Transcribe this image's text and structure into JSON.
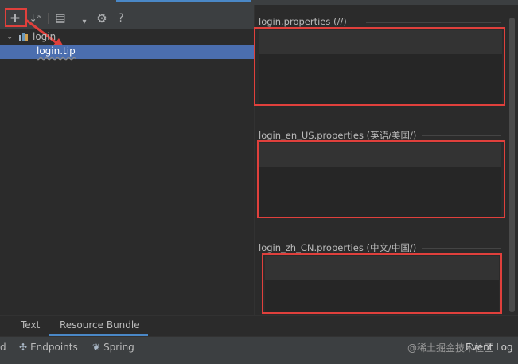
{
  "toolbar": {
    "add_icon": "+",
    "sort_icon": "↓ᵃ",
    "bundle_icon": "▤",
    "dropdown_icon": "▾",
    "gear_icon": "⚙",
    "help_icon": "?"
  },
  "tree": {
    "root_label": "login",
    "selected_item": "login.tip"
  },
  "sections": [
    {
      "title": "login.properties (//)"
    },
    {
      "title": "login_en_US.properties (英语/美国/)"
    },
    {
      "title": "login_zh_CN.properties (中文/中国/)"
    }
  ],
  "bottom_tabs": {
    "text": "Text",
    "resource_bundle": "Resource Bundle"
  },
  "statusbar": {
    "left_cut": "d",
    "endpoints": "Endpoints",
    "spring": "Spring",
    "watermark": "@稀土掘金技术社区",
    "event_log": "Event Log"
  },
  "colors": {
    "highlight": "#e0403c",
    "selection": "#4b6eaf",
    "accent": "#4a88c7"
  }
}
